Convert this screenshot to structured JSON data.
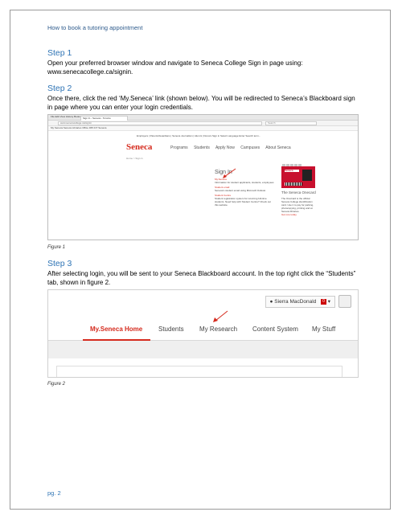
{
  "header": "How to book a tutoring appointment",
  "step1": {
    "title": "Step 1",
    "text_line1": "Open your preferred browser window and navigate to Seneca College Sign in page using:",
    "text_line2": "www.senecacollege.ca/signin."
  },
  "step2": {
    "title": "Step 2",
    "text": "Once there, click the red ‘My.Seneca’ link (shown below). You will be redirected to Seneca’s Blackboard sign in page where you can enter your login credentials."
  },
  "figure1": {
    "caption": "Figure 1",
    "browser": {
      "menu": "File  Edit  View  History  Bookmarks  Tools  Help",
      "tab_title": "Sign In - Seneca - Toronto",
      "url": "www.senecacollege.ca/signin",
      "search_placeholder": "Search",
      "bookmarks": "My Seneca  Seneca Libraries  Office 365  ICT Seneca"
    },
    "site": {
      "top_links": "Employers | Parents/Guardians | Seneca Journalism | Alumni | Donors    Sign in    Select Language    Enter Search term...",
      "logo": "Seneca",
      "nav": [
        "Programs",
        "Students",
        "Apply Now",
        "Campuses",
        "About Seneca"
      ],
      "breadcrumb": "Home > Sign in",
      "signin_title": "Sign In",
      "myseneca_link": "My.Seneca",
      "myseneca_desc": "Information for student applicants, students, employees",
      "email_link": "Student email",
      "email_desc": "Seneca's student email using Microsoft Outlook",
      "centre_link": "Student Centre",
      "centre_desc": "Student registration system for returning full-time students. Need help with Student Centre? Check out this website.",
      "card_brand": "Seneca",
      "onecard_title": "The Seneca Onecard",
      "onecard_desc": "The OneCard is the official Seneca College identification card. Use it to pay for parking, photocopying, printing and at Seneca libraries.",
      "onecard_link": "Get one today"
    }
  },
  "step3": {
    "title": "Step 3",
    "text": "After selecting login, you will be sent to your Seneca Blackboard account. In the top right click the “Students” tab, shown in figure 2."
  },
  "figure2": {
    "caption": "Figure 2",
    "user_name": "Sierra MacDonald",
    "notification_count": "0",
    "tabs": [
      "My.Seneca Home",
      "Students",
      "My Research",
      "Content System",
      "My Stuff"
    ]
  },
  "page_number": "pg. 2",
  "colors": {
    "heading": "#2e74b5",
    "seneca_red": "#d52b1e"
  }
}
